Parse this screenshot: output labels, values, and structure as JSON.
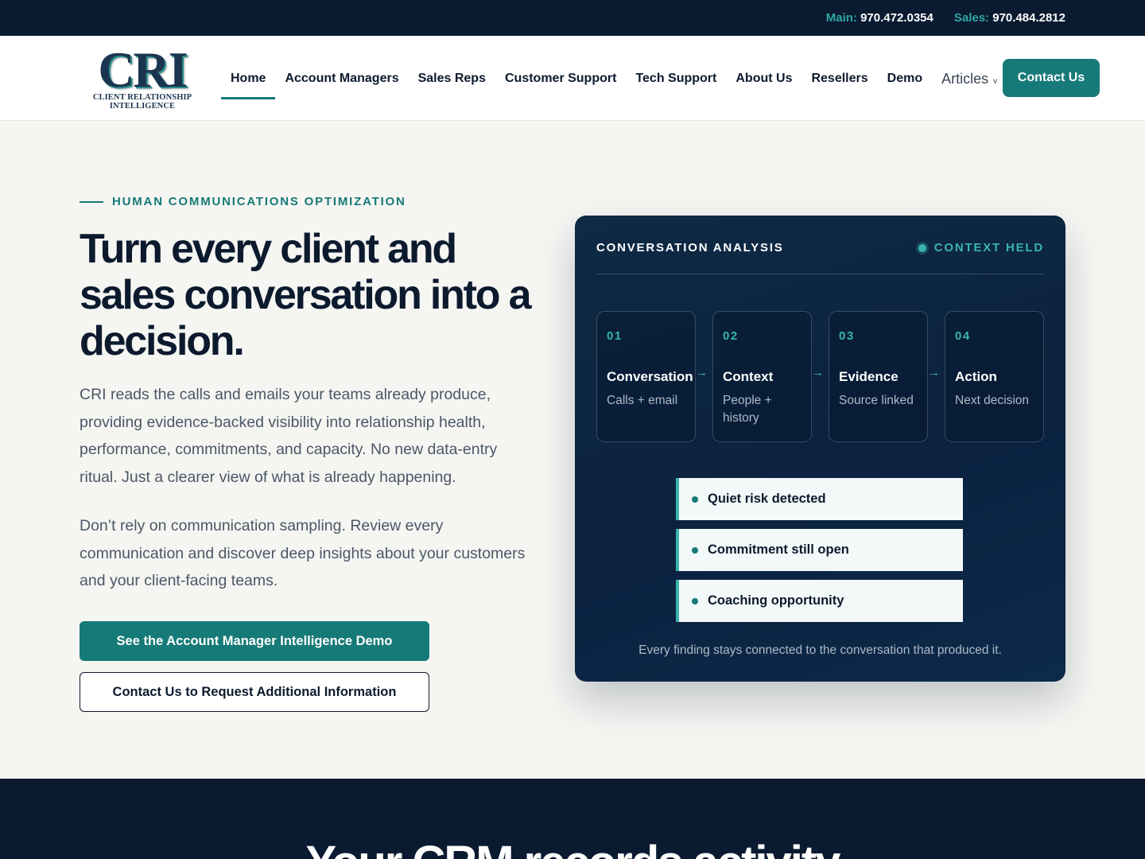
{
  "topbar": {
    "main_label": "Main:",
    "main_number": "970.472.0354",
    "sales_label": "Sales:",
    "sales_number": "970.484.2812"
  },
  "logo": {
    "mark": "CRI",
    "line1": "CLIENT RELATIONSHIP",
    "line2": "INTELLIGENCE"
  },
  "nav": {
    "items": [
      {
        "label": "Home",
        "active": true
      },
      {
        "label": "Account Managers"
      },
      {
        "label": "Sales Reps"
      },
      {
        "label": "Customer Support"
      },
      {
        "label": "Tech Support"
      },
      {
        "label": "About Us"
      },
      {
        "label": "Resellers"
      },
      {
        "label": "Demo"
      },
      {
        "label": "Articles",
        "has_dropdown": true
      }
    ],
    "articles_chevron": "v",
    "contact_label": "Contact Us"
  },
  "hero": {
    "eyebrow": "HUMAN COMMUNICATIONS OPTIMIZATION",
    "title": "Turn every client and sales conversation into a decision.",
    "paragraph1": "CRI reads the calls and emails your teams already produce, providing evidence-backed visibility into relationship health, performance, commitments, and capacity. No new data-entry ritual. Just a clearer view of what is already happening.",
    "paragraph2": "Don’t rely on communication sampling. Review every communication and discover deep insights about your customers and your client-facing teams.",
    "primary_button": "See the Account Manager Intelligence Demo",
    "secondary_button": "Contact Us to Request Additional Information"
  },
  "analysis_card": {
    "title": "CONVERSATION ANALYSIS",
    "status": "CONTEXT HELD",
    "steps": [
      {
        "num": "01",
        "name": "Conversation",
        "desc": "Calls + email"
      },
      {
        "num": "02",
        "name": "Context",
        "desc": "People + history"
      },
      {
        "num": "03",
        "name": "Evidence",
        "desc": "Source linked"
      },
      {
        "num": "04",
        "name": "Action",
        "desc": "Next decision"
      }
    ],
    "arrow": "→",
    "findings": [
      "Quiet risk detected",
      "Commitment still open",
      "Coaching opportunity"
    ],
    "footnote": "Every finding stays connected to the conversation that produced it."
  },
  "next_section": {
    "title_partial": "Your CRM records activity"
  },
  "colors": {
    "navy": "#0a1a30",
    "teal": "#167a78",
    "teal_light": "#3ab5ad",
    "page_bg": "#f5f5f2"
  }
}
